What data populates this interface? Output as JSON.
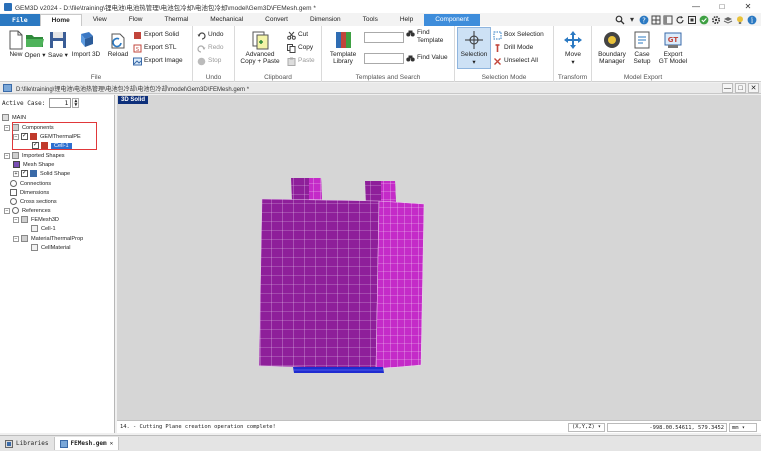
{
  "window": {
    "title": "GEM3D v2024 - D:\\file\\training\\锂电池\\电池热管理\\电池包冷却\\电池包冷却\\model\\Gem3D\\FEMesh.gem *",
    "controls": [
      "—",
      "□",
      "✕"
    ]
  },
  "ribbon_tabs": [
    "File",
    "Home",
    "View",
    "Flow",
    "Thermal",
    "Mechanical",
    "Convert",
    "Dimension",
    "Tools",
    "Help",
    "Component"
  ],
  "active_tab": "Home",
  "ribbon": {
    "file_group": {
      "label": "File",
      "new": "New",
      "open": "Open",
      "save": "Save",
      "import3d": "Import 3D",
      "reload": "Reload",
      "export_solid": "Export Solid",
      "export_stl": "Export STL",
      "export_image": "Export Image"
    },
    "undo_group": {
      "label": "Undo",
      "undo": "Undo",
      "redo": "Redo",
      "stop": "Stop"
    },
    "clipboard_group": {
      "label": "Clipboard",
      "advanced_copy_paste_line1": "Advanced",
      "advanced_copy_paste_line2": "Copy + Paste",
      "cut": "Cut",
      "copy": "Copy",
      "paste": "Paste"
    },
    "templates_group": {
      "label": "Templates and Search",
      "template_library_line1": "Template",
      "template_library_line2": "Library",
      "find_template_line1": "Find",
      "find_template_line2": "Template",
      "find_value": "Find Value"
    },
    "selection_group": {
      "label": "Selection Mode",
      "selection": "Selection",
      "box_selection": "Box Selection",
      "drill_mode": "Drill Mode",
      "unselect_all": "Unselect All"
    },
    "transform_group": {
      "label": "Transform",
      "move": "Move"
    },
    "model_export_group": {
      "label": "Model Export",
      "boundary_manager_line1": "Boundary",
      "boundary_manager_line2": "Manager",
      "case_setup_line1": "Case",
      "case_setup_line2": "Setup",
      "export_gt_model_line1": "Export",
      "export_gt_model_line2": "GT Model"
    }
  },
  "document_path": "D:\\file\\training\\锂电池\\电池热管理\\电池包冷却\\电池包冷却\\model\\Gem3D\\FEMesh.gem *",
  "left_panel": {
    "active_case_label": "Active Case:",
    "active_case_value": "1",
    "tree": {
      "main": "MAIN",
      "components": "Components",
      "gem_thermal_pe": "GEMThermalPE",
      "cell1": "Cell-1",
      "imported_shapes": "Imported Shapes",
      "mesh_shape": "Mesh Shape",
      "solid_shape": "Solid Shape",
      "connections": "Connections",
      "dimensions": "Dimensions",
      "cross_sections": "Cross sections",
      "references": "References",
      "femesh3d": "FEMesh3D",
      "femesh_cell1": "Cell-1",
      "material_thermal_prop": "MaterialThermalProp",
      "cell_material": "CellMaterial"
    }
  },
  "viewport": {
    "label": "3D Solid"
  },
  "status": {
    "message": "14. - Cutting Plane creation operation complete!",
    "coord_system": "(X,Y,Z)",
    "coords": "-998.00.54611, 579.3452",
    "unit": "mm"
  },
  "bottom_tabs": [
    "Libraries",
    "FEMesh.gem"
  ],
  "colors": {
    "file_tab": "#2b79c2",
    "component_tab": "#3e8ddb",
    "mesh_dark": "#8e1f9a",
    "mesh_light": "#c42bc8",
    "cooling_plate": "#1f2bd0",
    "selection_box": "#e0383a"
  }
}
